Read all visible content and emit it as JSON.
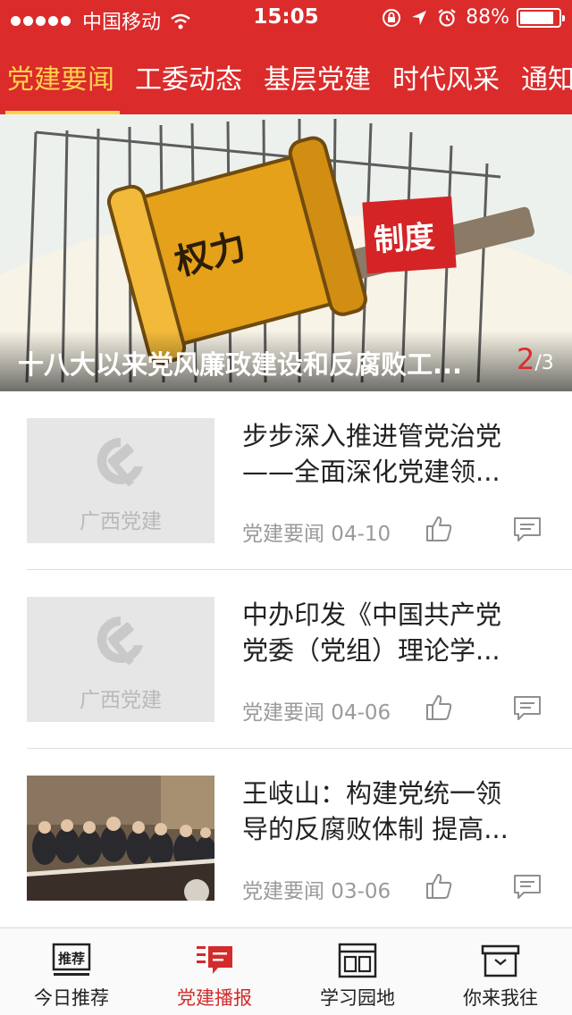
{
  "status_bar": {
    "carrier": "中国移动",
    "time": "15:05",
    "battery": "88%",
    "battery_level": 0.88
  },
  "category_tabs": [
    {
      "label": "党建要闻",
      "active": true
    },
    {
      "label": "工委动态",
      "active": false
    },
    {
      "label": "基层党建",
      "active": false
    },
    {
      "label": "时代风采",
      "active": false
    },
    {
      "label": "通知",
      "active": false
    }
  ],
  "banner": {
    "title": "十八大以来党风廉政建设和反腐败工...",
    "current_page": "2",
    "total_pages": "/3",
    "image_text": {
      "left": "权力",
      "right": "制度"
    }
  },
  "news": [
    {
      "title_line1": "步步深入推进管党治党",
      "title_line2": "——全面深化党建领...",
      "meta": "党建要闻 04-10",
      "thumb": "placeholder",
      "thumb_text": "广西党建"
    },
    {
      "title_line1": "中办印发《中国共产党",
      "title_line2": "党委（党组）理论学...",
      "meta": "党建要闻 04-06",
      "thumb": "placeholder",
      "thumb_text": "广西党建"
    },
    {
      "title_line1": "王岐山：构建党统一领",
      "title_line2": "导的反腐败体制 提高...",
      "meta": "党建要闻 03-06",
      "thumb": "photo"
    }
  ],
  "tabbar": [
    {
      "label": "今日推荐",
      "icon": "recommend-icon",
      "badge": "推荐",
      "active": false
    },
    {
      "label": "党建播报",
      "icon": "broadcast-icon",
      "active": true
    },
    {
      "label": "学习园地",
      "icon": "study-icon",
      "active": false
    },
    {
      "label": "你来我往",
      "icon": "inbox-icon",
      "active": false
    }
  ],
  "colors": {
    "header_red": "#db2b2b",
    "active_tab_yellow": "#ffd24d",
    "accent_red": "#d32b2b"
  }
}
